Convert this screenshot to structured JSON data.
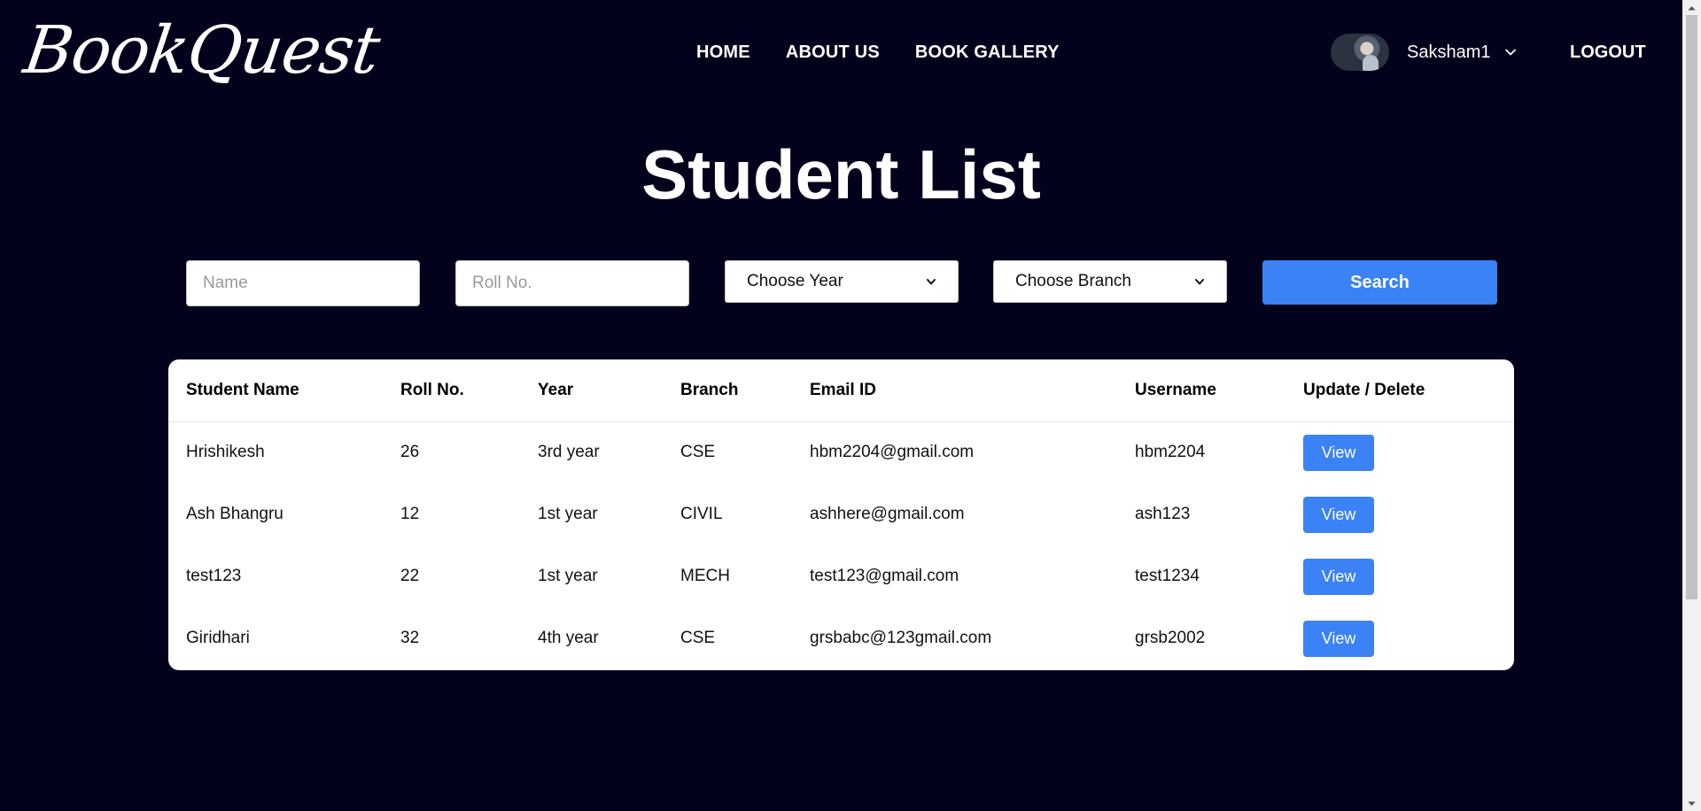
{
  "header": {
    "logo": "BookQuest",
    "nav": [
      {
        "label": "HOME"
      },
      {
        "label": "ABOUT US"
      },
      {
        "label": "BOOK GALLERY"
      }
    ],
    "user": {
      "name": "Saksham1"
    },
    "logout_label": "LOGOUT"
  },
  "page_title": "Student List",
  "filters": {
    "name_placeholder": "Name",
    "roll_placeholder": "Roll No.",
    "year_selected": "Choose Year",
    "branch_selected": "Choose Branch",
    "search_label": "Search"
  },
  "table": {
    "headers": [
      "Student Name",
      "Roll No.",
      "Year",
      "Branch",
      "Email ID",
      "Username",
      "Update / Delete"
    ],
    "rows": [
      {
        "name": "Hrishikesh",
        "roll": "26",
        "year": "3rd year",
        "branch": "CSE",
        "email": "hbm2204@gmail.com",
        "username": "hbm2204",
        "action": "View"
      },
      {
        "name": "Ash Bhangru",
        "roll": "12",
        "year": "1st year",
        "branch": "CIVIL",
        "email": "ashhere@gmail.com",
        "username": "ash123",
        "action": "View"
      },
      {
        "name": "test123",
        "roll": "22",
        "year": "1st year",
        "branch": "MECH",
        "email": "test123@gmail.com",
        "username": "test1234",
        "action": "View"
      },
      {
        "name": "Giridhari",
        "roll": "32",
        "year": "4th year",
        "branch": "CSE",
        "email": "grsbabc@123gmail.com",
        "username": "grsb2002",
        "action": "View"
      }
    ]
  },
  "colors": {
    "background": "#03021c",
    "accent": "#3b82f6",
    "card": "#ffffff"
  },
  "icons": {
    "user_menu": "chevron-down-icon",
    "select": "select-arrow-icon"
  }
}
